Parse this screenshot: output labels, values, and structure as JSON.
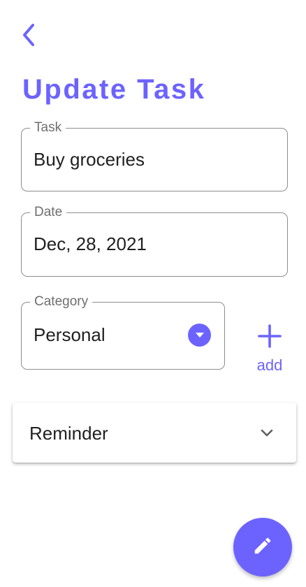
{
  "header": {
    "back_icon": "back-arrow-icon",
    "title": "Update Task"
  },
  "form": {
    "task": {
      "label": "Task",
      "value": "Buy groceries"
    },
    "date": {
      "label": "Date",
      "value": "Dec, 28, 2021"
    },
    "category": {
      "label": "Category",
      "value": "Personal",
      "icon": "dropdown-arrow-icon"
    },
    "add_category": {
      "label": "add",
      "icon": "plus-icon"
    }
  },
  "reminder": {
    "label": "Reminder",
    "icon": "chevron-down-icon"
  },
  "fab": {
    "icon": "edit-pencil-icon"
  },
  "colors": {
    "accent": "#6c63ff",
    "border": "#8e8e8e",
    "label": "#6e6e6e",
    "text": "#212121"
  }
}
